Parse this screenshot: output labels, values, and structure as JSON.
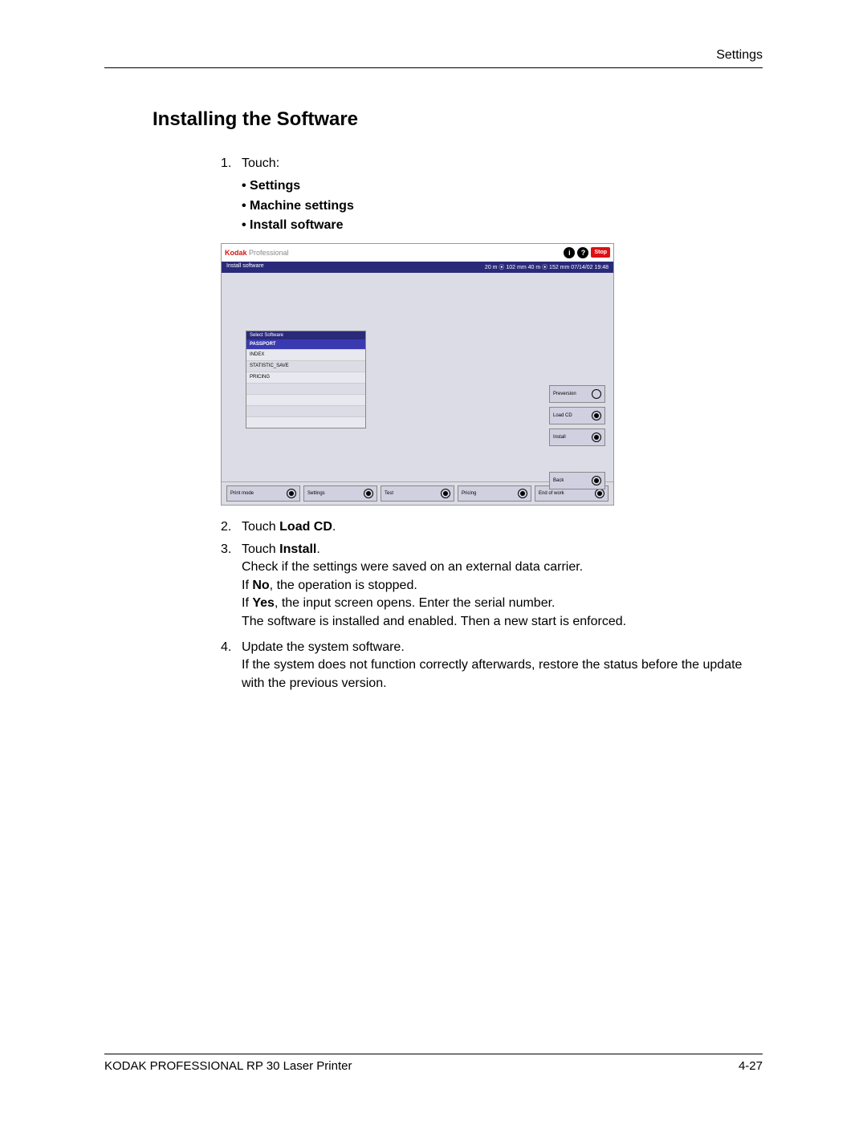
{
  "header": {
    "right": "Settings"
  },
  "title": "Installing the Software",
  "steps": {
    "s1": "Touch:",
    "bullets": [
      "Settings",
      "Machine settings",
      "Install software"
    ],
    "s2_pre": "Touch ",
    "s2_bold": "Load CD",
    "s2_post": ".",
    "s3_pre": "Touch ",
    "s3_bold": "Install",
    "s3_post": ".",
    "s3_l1": "Check if the settings were saved on an external data carrier.",
    "s3_l2a": "If ",
    "s3_l2b": "No",
    "s3_l2c": ", the operation is stopped.",
    "s3_l3a": "If ",
    "s3_l3b": "Yes",
    "s3_l3c": ", the input screen opens. Enter the serial number.",
    "s3_l4": "The software is installed and enabled. Then a new start is enforced.",
    "s4a": "Update the system software.",
    "s4b": "If the system does not function correctly afterwards, restore the status before the update with the previous version."
  },
  "shot": {
    "brand1": "Kodak",
    "brand2": " Professional",
    "stop": "Stop",
    "status_left": "Install software",
    "status_right": "20 m ⦿ 102 mm   40 m ⦿ 152 mm  07/14/02    19:48",
    "list_header": "Select Software",
    "list_selected": "PASSPORT",
    "list_items": [
      "INDEX",
      "STATISTIC_SAVE",
      "PRICING"
    ],
    "side": {
      "preversion": "Preversion",
      "loadcd": "Load CD",
      "install": "Install",
      "back": "Back"
    },
    "bottom": [
      "Print mode",
      "Settings",
      "Test",
      "Pricing",
      "End of work"
    ]
  },
  "footer": {
    "left": "KODAK PROFESSIONAL RP 30 Laser Printer",
    "right": "4-27"
  }
}
